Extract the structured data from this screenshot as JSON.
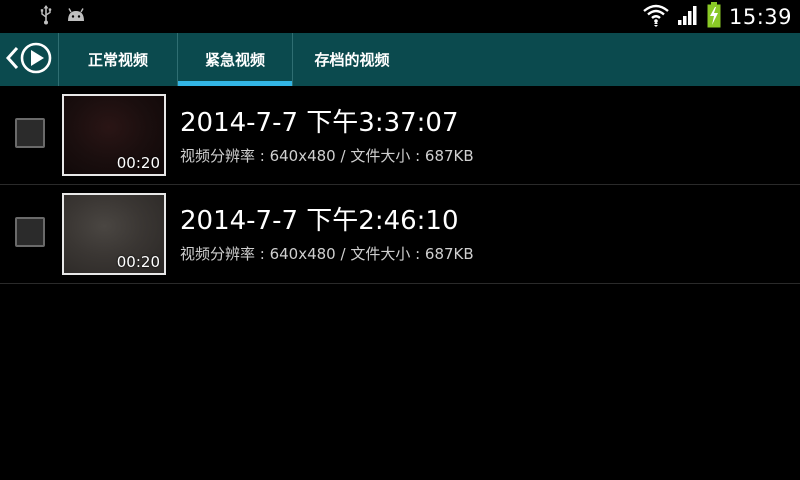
{
  "status_bar": {
    "left_icons": [
      "usb-icon",
      "android-icon"
    ],
    "right_icons": [
      "wifi-icon",
      "signal-icon",
      "battery-charging-icon"
    ],
    "time": "15:39"
  },
  "action_bar": {
    "nav_icon": "back-play-icon",
    "tabs": [
      {
        "label": "正常视频",
        "selected": false
      },
      {
        "label": "紧急视频",
        "selected": true
      },
      {
        "label": "存档的视频",
        "selected": false
      }
    ]
  },
  "videos": [
    {
      "title": "2014-7-7 下午3:37:07",
      "meta": "视频分辨率 : 640x480 / 文件大小 : 687KB",
      "duration": "00:20",
      "checked": false
    },
    {
      "title": "2014-7-7 下午2:46:10",
      "meta": "视频分辨率 : 640x480 / 文件大小 : 687KB",
      "duration": "00:20",
      "checked": false
    }
  ],
  "colors": {
    "action_bar_bg": "#0b4a4e",
    "tab_indicator": "#33b5e5",
    "battery_charging": "#8ac926"
  }
}
